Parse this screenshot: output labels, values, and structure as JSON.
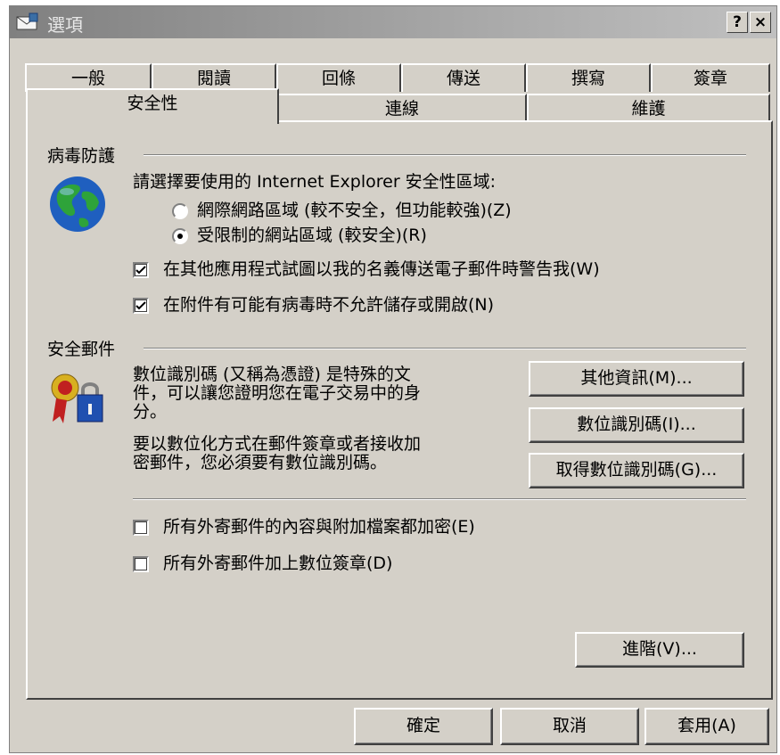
{
  "window": {
    "title": "選項",
    "help_button": "?",
    "close_button": "×"
  },
  "tabs_back": [
    "一般",
    "閱讀",
    "回條",
    "傳送",
    "撰寫",
    "簽章"
  ],
  "tabs_front": {
    "active": "安全性",
    "second": "連線",
    "third": "維護"
  },
  "virus_protection": {
    "section_title": "病毒防護",
    "zone_prompt": "請選擇要使用的 Internet Explorer 安全性區域:",
    "radio_internet": "網際網路區域 (較不安全，但功能較強)(Z)",
    "radio_restricted": "受限制的網站區域 (較安全)(R)",
    "selected_zone": "restricted",
    "check_warn": "在其他應用程式試圖以我的名義傳送電子郵件時警告我(W)",
    "check_warn_checked": true,
    "check_block": "在附件有可能有病毒時不允許儲存或開啟(N)",
    "check_block_checked": true
  },
  "secure_mail": {
    "section_title": "安全郵件",
    "desc1_line1": "數位識別碼 (又稱為憑證) 是特殊的文",
    "desc1_line2": "件，可以讓您證明您在電子交易中的身",
    "desc1_line3": "分。",
    "desc2_line1": "要以數位化方式在郵件簽章或者接收加",
    "desc2_line2": "密郵件，您必須要有數位識別碼。",
    "btn_more_info": "其他資訊(M)...",
    "btn_digital_ids": "數位識別碼(I)...",
    "btn_get_id": "取得數位識別碼(G)...",
    "check_encrypt": "所有外寄郵件的內容與附加檔案都加密(E)",
    "check_encrypt_checked": false,
    "check_sign": "所有外寄郵件加上數位簽章(D)",
    "check_sign_checked": false
  },
  "advanced_button": "進階(V)...",
  "footer": {
    "ok": "確定",
    "cancel": "取消",
    "apply": "套用(A)"
  }
}
